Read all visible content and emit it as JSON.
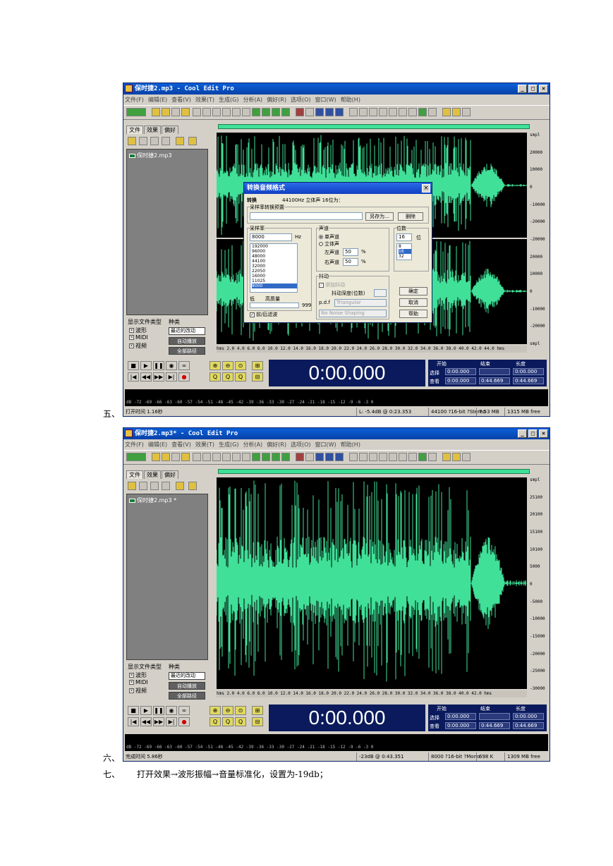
{
  "steps": {
    "s5": "五、",
    "s6": "六、",
    "s7": "七、",
    "s7_text": "打开效果→波形振幅→音量标准化，设置为-19db；"
  },
  "window1": {
    "title": "保时捷2.mp3 - Cool Edit Pro",
    "menu": [
      "文件(F)",
      "编辑(E)",
      "查看(V)",
      "效果(T)",
      "生成(G)",
      "分析(A)",
      "偏好(R)",
      "选项(O)",
      "窗口(W)",
      "帮助(H)"
    ],
    "tabs": [
      "文件",
      "效果",
      "偏好"
    ],
    "file_item": "保时捷2.mp3",
    "show_file_types_label": "显示文件类型",
    "sort_label": "种类",
    "file_types": [
      "波形",
      "MIDI",
      "视频"
    ],
    "sort_value": "最近的改动",
    "auto_play": "自动播放",
    "full_path": "全部路径",
    "ruler_labels": [
      "smpl",
      "20000",
      "10000",
      "0",
      "-10000",
      "-20000",
      "-20000",
      "20000",
      "10000",
      "0",
      "-10000",
      "-20000",
      "smpl"
    ],
    "time_labels": "hms 2.0  4.0  6.0  8.0  10.0  12.0  14.0  16.0  18.0  20.0  22.0  24.0  26.0  28.0  30.0  32.0  34.0  36.0  38.0  40.0  42.0  44.0  hms",
    "time_display": "0:00.000",
    "sel_headers": [
      "开始",
      "结束",
      "长度"
    ],
    "sel_row_labels": [
      "选择",
      "查看"
    ],
    "sel_values": [
      [
        "0:00.000",
        "",
        "0:00.000"
      ],
      [
        "0:00.000",
        "0:44.669",
        "0:44.669"
      ]
    ],
    "level_scale": "dB  -72   -69   -66   -63   -60   -57   -54   -51   -48   -45   -42   -39   -36   -33   -30   -27   -24   -21   -18   -15   -12    -9    -6    -3    0",
    "status": [
      "打开时间 1.16秒",
      "L: -5.4dB @  0:23.353",
      "44100 ?16-bit ?Stereo",
      "7.53 MB",
      "1315 MB free"
    ]
  },
  "dialog": {
    "title": "转换音频格式",
    "source_label": "转换",
    "source_value": "44100Hz 立体声 16位为：",
    "preset_label": "采样率转换预置",
    "save_as": "另存为...",
    "delete": "删除",
    "sample_rate_label": "采样率",
    "sample_rate_value": "8000",
    "hz": "Hz",
    "rates": [
      "192000",
      "96000",
      "48000",
      "44100",
      "32000",
      "22050",
      "16000",
      "11025",
      "8000"
    ],
    "low_label": "低",
    "high_label": "高质量",
    "quality_value": "999",
    "pre_post": "前/后滤波",
    "channels_label": "声道",
    "mono": "单声道",
    "stereo": "立体声",
    "left_label": "左声道",
    "left_value": "50",
    "right_label": "右声道",
    "right_value": "50",
    "pct": "%",
    "bits_label": "位数",
    "bits_value": "16",
    "bits_unit": "位",
    "bits_list": [
      "8",
      "16",
      "32"
    ],
    "dither_label": "抖动",
    "enable_dither": "添加抖动",
    "dither_depth": "抖动深度(位数)",
    "pdf_label": "p.d.f",
    "pdf_value": "Triangular",
    "shaping_value": "No Noise Shaping",
    "ok": "确定",
    "cancel": "取消",
    "help": "帮助"
  },
  "window2": {
    "title": "保时捷2.mp3* - Cool Edit Pro",
    "menu": [
      "文件(F)",
      "编辑(E)",
      "查看(V)",
      "效果(T)",
      "生成(G)",
      "分析(A)",
      "偏好(R)",
      "选项(O)",
      "窗口(W)",
      "帮助(H)"
    ],
    "tabs": [
      "文件",
      "效果",
      "偏好"
    ],
    "file_item": "保时捷2.mp3 *",
    "show_file_types_label": "显示文件类型",
    "sort_label": "种类",
    "file_types": [
      "波形",
      "MIDI",
      "视频"
    ],
    "sort_value": "最近的改动",
    "auto_play": "自动播放",
    "full_path": "全部路径",
    "ruler_labels": [
      "smpl",
      "25100",
      "20100",
      "15100",
      "10100",
      "5000",
      "0",
      "-5000",
      "-10000",
      "-15000",
      "-20000",
      "-25000",
      "-30000"
    ],
    "time_labels": "hms 2.0  4.0  6.0  8.0  10.0  12.0  14.0  16.0  18.0  20.0  22.0  24.0  26.0  28.0  30.0  32.0  34.0  36.0  38.0  40.0  42.0  hms",
    "time_display": "0:00.000",
    "sel_headers": [
      "开始",
      "结束",
      "长度"
    ],
    "sel_row_labels": [
      "选择",
      "查看"
    ],
    "sel_values": [
      [
        "0:00.000",
        "",
        "0:00.000"
      ],
      [
        "0:00.000",
        "0:44.669",
        "0:44.669"
      ]
    ],
    "level_scale": "dB  -72   -69   -66   -63   -60   -57   -54   -51   -48   -45   -42   -39   -36   -33   -30   -27   -24   -21   -18   -15   -12    -9    -6    -3    0",
    "status": [
      "完成时间 5.86秒",
      "-23dB @  0:43.351",
      "8000 ?16-bit ?Mono",
      "698 K",
      "1309 MB free"
    ]
  },
  "colors": {
    "wave": "#40e098",
    "time_panel": "#0a1a5c",
    "title_bar": "#0a5fd8"
  }
}
